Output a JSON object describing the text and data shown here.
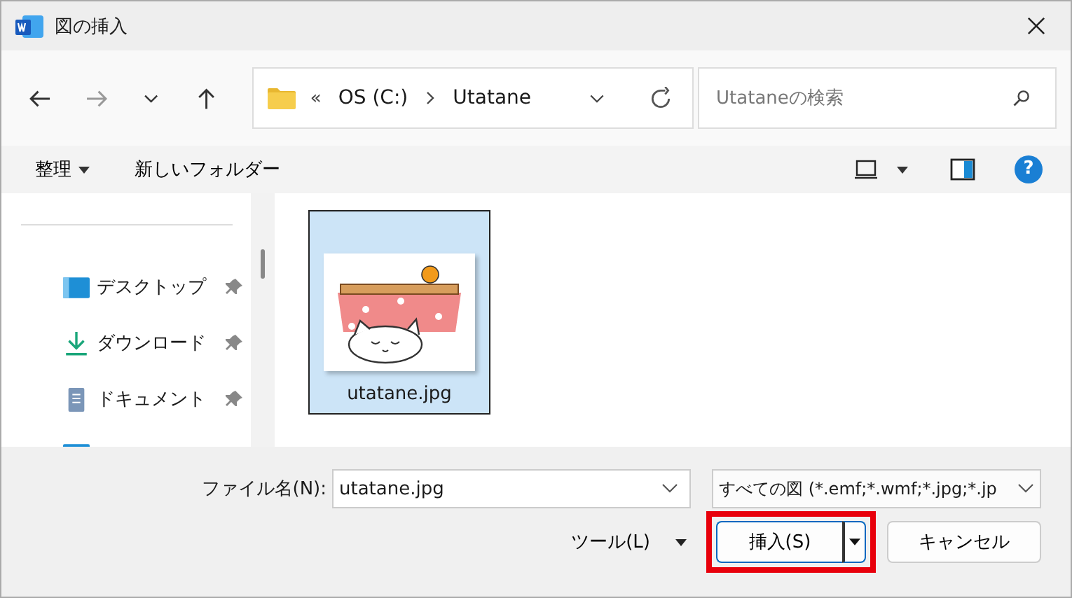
{
  "window": {
    "title": "図の挿入"
  },
  "nav": {
    "overflow": "«",
    "breadcrumb": [
      "OS (C:)",
      "Utatane"
    ],
    "search": {
      "placeholder": "Utataneの検索"
    }
  },
  "toolbar": {
    "organize": "整理",
    "new_folder": "新しいフォルダー",
    "help": "?"
  },
  "sidebar": {
    "items": [
      {
        "label": "デスクトップ",
        "kind": "desktop"
      },
      {
        "label": "ダウンロード",
        "kind": "download"
      },
      {
        "label": "ドキュメント",
        "kind": "document"
      }
    ]
  },
  "files": [
    {
      "name": "utatane.jpg",
      "selected": true
    }
  ],
  "footer": {
    "filename_label": "ファイル名(N):",
    "filename": "utatane.jpg",
    "filter": "すべての図 (*.emf;*.wmf;*.jpg;*.jp",
    "tools": "ツール(L)",
    "insert": "挿入(S)",
    "cancel": "キャンセル"
  }
}
